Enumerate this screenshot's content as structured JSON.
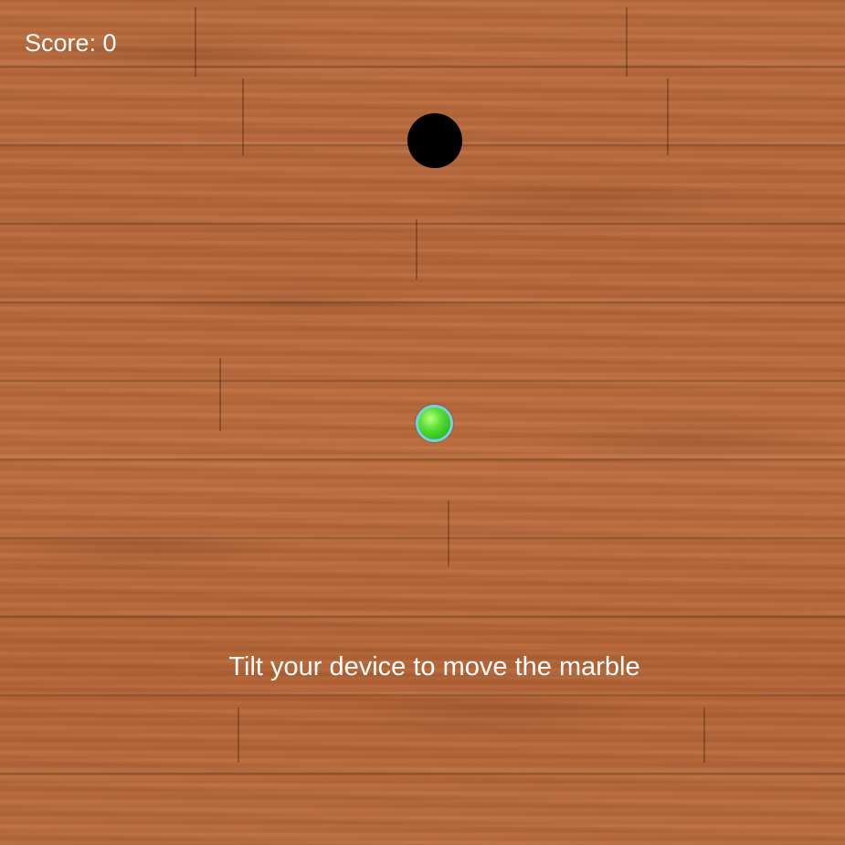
{
  "hud": {
    "score_label": "Score: 0"
  },
  "game": {
    "instruction": "Tilt your device to move the marble",
    "marble_color": "#4cd62c",
    "marble_rim_color": "#6fd2e6",
    "hole_color": "#000000",
    "text_color": "#ffffff",
    "board_texture": "wood-planks"
  }
}
